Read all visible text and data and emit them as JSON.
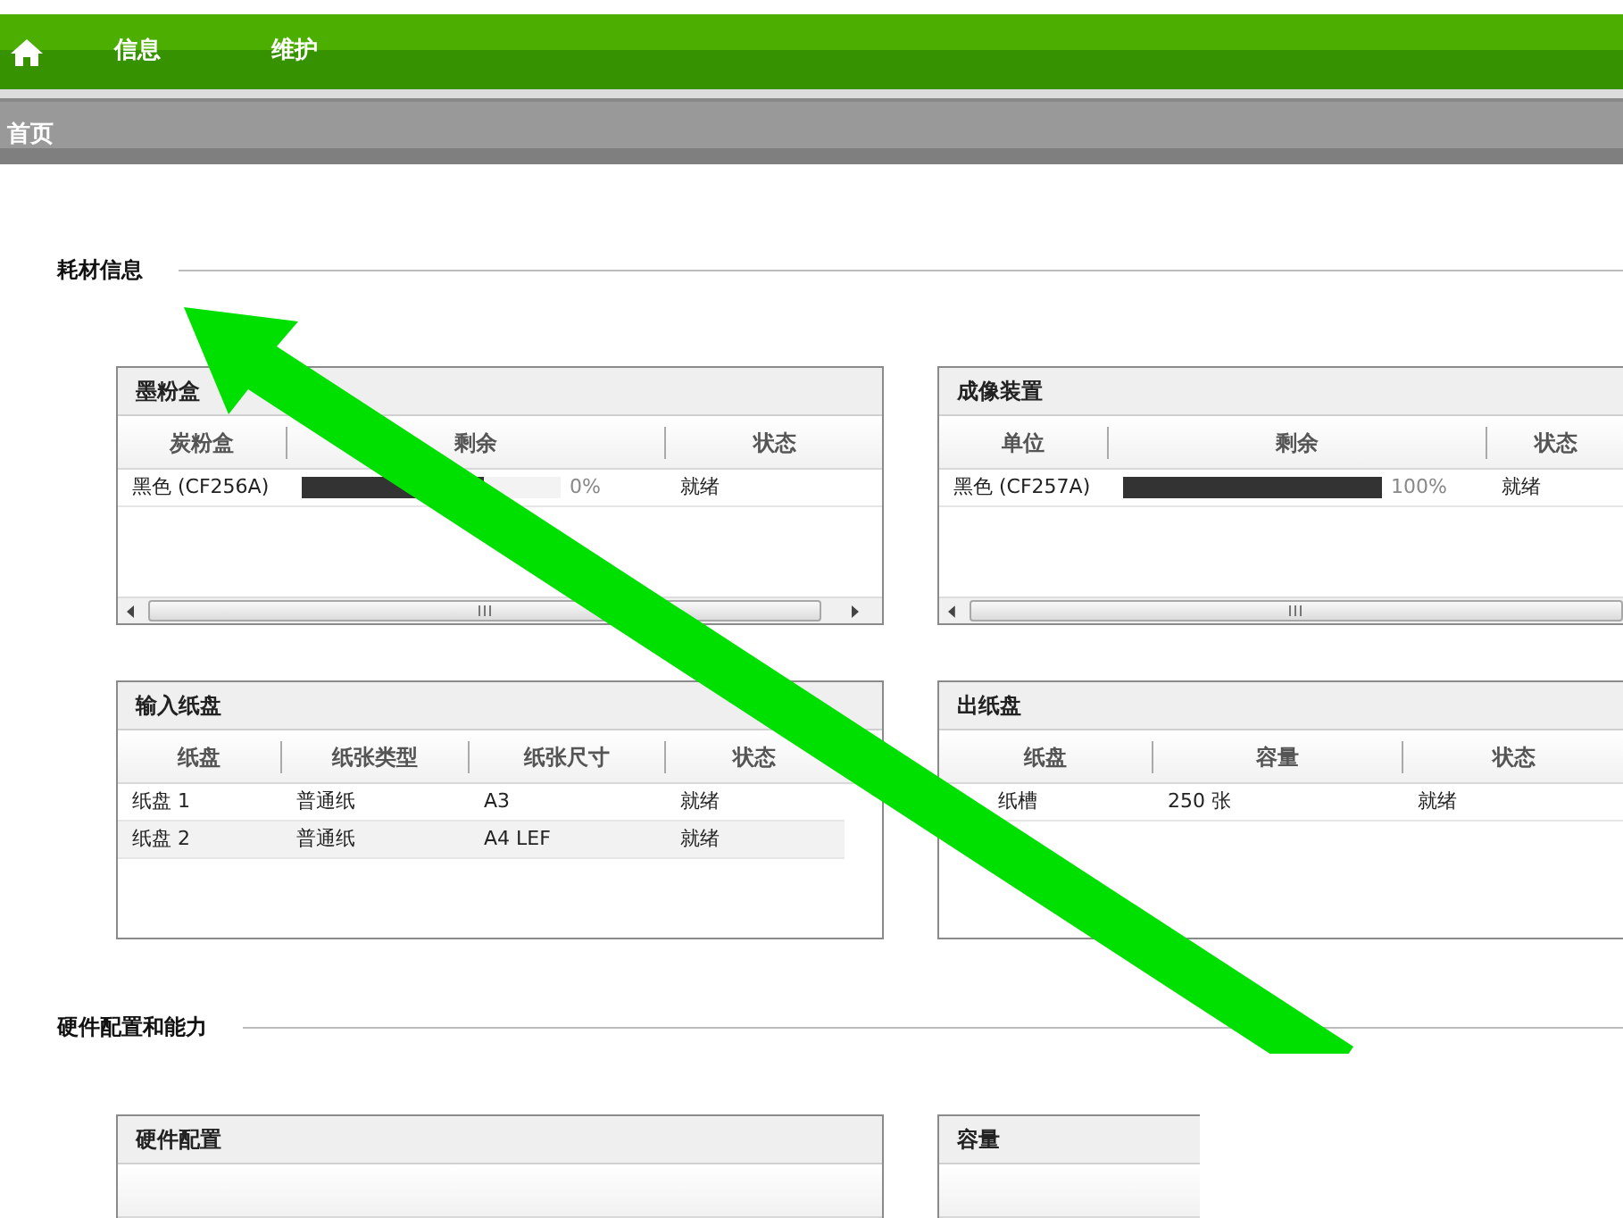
{
  "nav": {
    "items": [
      "信息",
      "维护"
    ]
  },
  "breadcrumb": "首页",
  "sections": [
    {
      "title": "耗材信息",
      "panels": [
        {
          "title": "墨粉盒",
          "scrollbar": true,
          "columns": [
            "炭粉盒",
            "剩余",
            "状态"
          ],
          "rows": [
            [
              {
                "text": "黑色 (CF256A)"
              },
              {
                "kind": "meter",
                "level": 0.7,
                "reading": "0%"
              },
              {
                "text": "就绪"
              }
            ]
          ]
        },
        {
          "title": "成像装置",
          "scrollbar": true,
          "columns": [
            "单位",
            "剩余",
            "状态"
          ],
          "rows": [
            [
              {
                "text": "黑色 (CF257A)"
              },
              {
                "kind": "meter",
                "level": 1,
                "reading": "100%"
              },
              {
                "text": "就绪"
              }
            ]
          ]
        },
        {
          "title": "输入纸盘",
          "columns": [
            "纸盘",
            "纸张类型",
            "纸张尺寸",
            "状态"
          ],
          "rows": [
            [
              {
                "text": "纸盘 1"
              },
              {
                "text": "普通纸"
              },
              {
                "text": "A3"
              },
              {
                "text": "就绪"
              }
            ],
            [
              {
                "text": "纸盘 2"
              },
              {
                "text": "普通纸"
              },
              {
                "text": "A4 LEF"
              },
              {
                "text": "就绪"
              }
            ]
          ]
        },
        {
          "title": "出纸盘",
          "columns": [
            "纸盘",
            "容量",
            "状态"
          ],
          "rows": [
            [
              {
                "text": "纸槽"
              },
              {
                "text": "250 张"
              },
              {
                "text": "就绪"
              }
            ]
          ]
        }
      ]
    },
    {
      "title": "硬件配置和能力",
      "panels": [
        {
          "title": "硬件配置"
        },
        {
          "title": "容量"
        }
      ]
    }
  ]
}
